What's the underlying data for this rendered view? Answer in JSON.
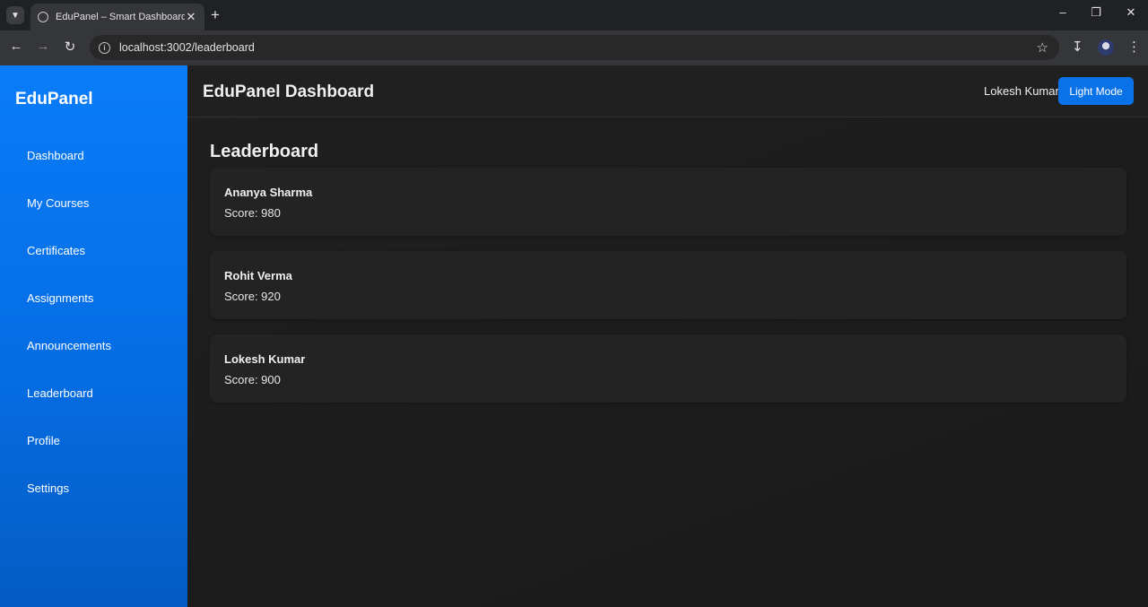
{
  "browser": {
    "tab_title": "EduPanel – Smart Dashboard",
    "url": "localhost:3002/leaderboard"
  },
  "sidebar": {
    "brand": "EduPanel",
    "items": [
      {
        "label": "Dashboard"
      },
      {
        "label": "My Courses"
      },
      {
        "label": "Certificates"
      },
      {
        "label": "Assignments"
      },
      {
        "label": "Announcements"
      },
      {
        "label": "Leaderboard"
      },
      {
        "label": "Profile"
      },
      {
        "label": "Settings"
      }
    ]
  },
  "header": {
    "title": "EduPanel Dashboard",
    "user_name": "Lokesh Kumar",
    "mode_button": "Light Mode"
  },
  "leaderboard": {
    "title": "Leaderboard",
    "entries": [
      {
        "name": "Ananya Sharma",
        "score": "Score: 980"
      },
      {
        "name": "Rohit Verma",
        "score": "Score: 920"
      },
      {
        "name": "Lokesh Kumar",
        "score": "Score: 900"
      }
    ]
  },
  "colors": {
    "sidebar_accent": "#0a7cf8",
    "button_accent": "#0a72e8",
    "background": "#1c1c1c",
    "card": "#232323"
  }
}
